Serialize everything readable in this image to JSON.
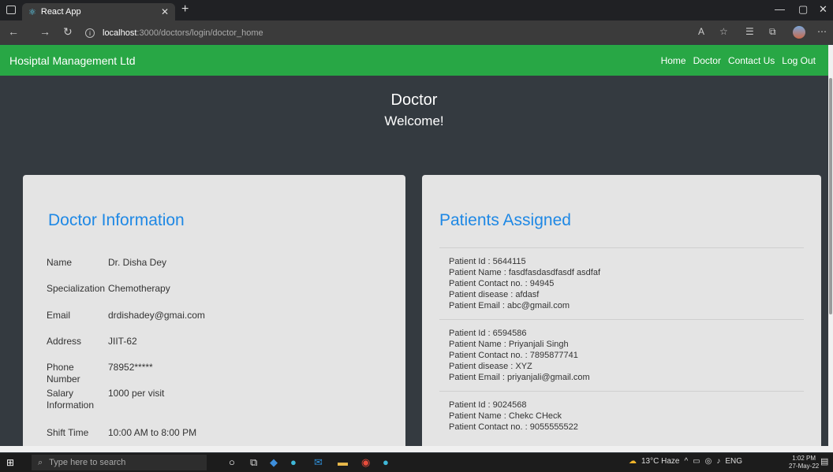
{
  "browser": {
    "tab_title": "React App",
    "url_host": "localhost",
    "url_path": ":3000/doctors/login/doctor_home"
  },
  "navbar": {
    "brand": "Hosiptal Management Ltd",
    "links": [
      "Home",
      "Doctor",
      "Contact Us",
      "Log Out"
    ]
  },
  "hero": {
    "title": "Doctor",
    "subtitle": "Welcome!"
  },
  "doctor_info": {
    "heading": "Doctor Information",
    "rows": [
      {
        "label": "Name",
        "value": "Dr. Disha Dey"
      },
      {
        "label": "Specialization",
        "value": "Chemotherapy"
      },
      {
        "label": "Email",
        "value": "drdishadey@gmai.com"
      },
      {
        "label": "Address",
        "value": "JIIT-62"
      },
      {
        "label": "Phone Number",
        "value": "78952*****"
      },
      {
        "label": "Salary Information",
        "value": "1000 per visit"
      },
      {
        "label": "Shift Time",
        "value": "10:00 AM to 8:00 PM"
      }
    ]
  },
  "patients": {
    "heading": "Patients Assigned",
    "list": [
      {
        "id": "Patient Id : 5644115",
        "name": "Patient Name : fasdfasdasdfasdf asdfaf",
        "contact": "Patient Contact no. : 94945",
        "disease": "Patient disease : afdasf",
        "email": "Patient Email : abc@gmail.com"
      },
      {
        "id": "Patient Id : 6594586",
        "name": "Patient Name : Priyanjali Singh",
        "contact": "Patient Contact no. : 7895877741",
        "disease": "Patient disease : XYZ",
        "email": "Patient Email : priyanjali@gmail.com"
      },
      {
        "id": "Patient Id : 9024568",
        "name": "Patient Name : Chekc CHeck",
        "contact": "Patient Contact no. : 9055555522",
        "disease": "",
        "email": ""
      }
    ]
  },
  "taskbar": {
    "search_placeholder": "Type here to search",
    "weather": "13°C Haze",
    "lang": "ENG",
    "time": "1:02 PM",
    "date": "27-May-22"
  },
  "colors": {
    "navbar": "#28a745",
    "background": "#343a40",
    "card": "#e4e4e4",
    "heading": "#1e88e5"
  }
}
